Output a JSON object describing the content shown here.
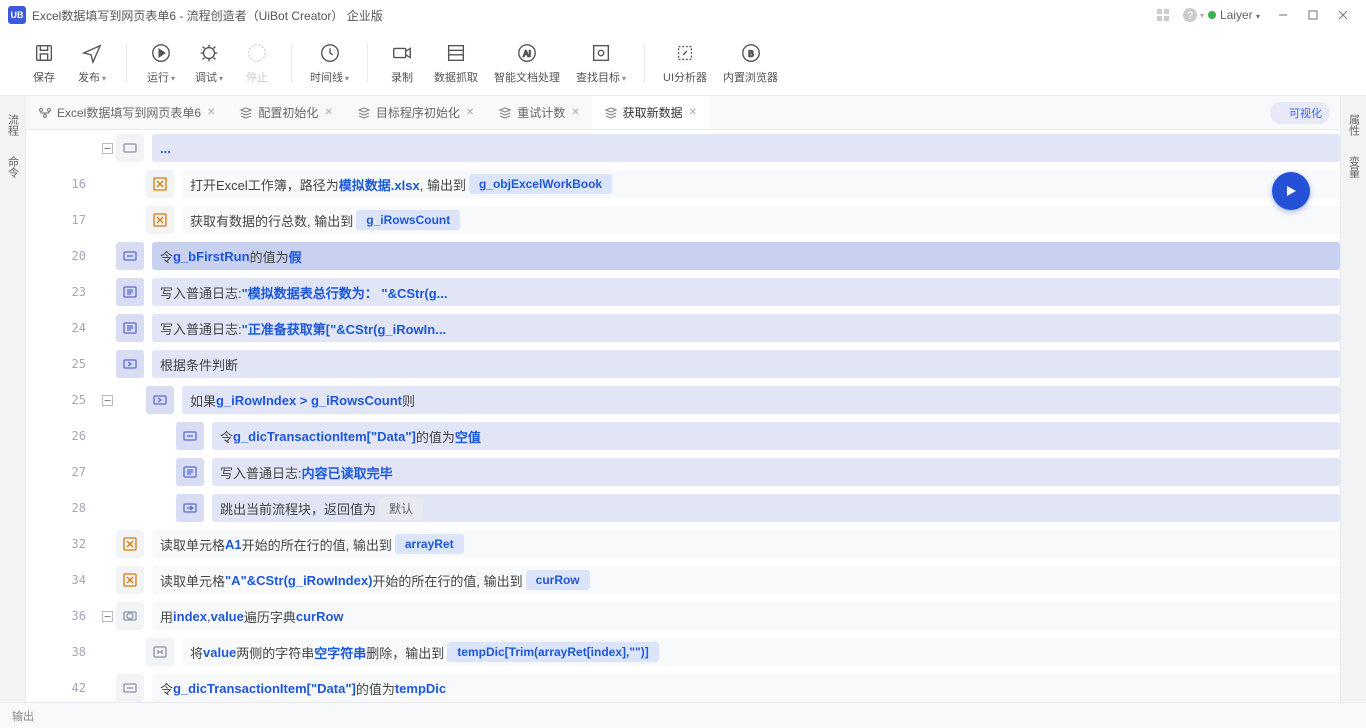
{
  "title": "Excel数据填写到网页表单6 - 流程创造者（UiBot Creator）  企业版",
  "user": "Laiyer",
  "toolbar": [
    {
      "id": "save",
      "label": "保存",
      "svg": "save"
    },
    {
      "id": "pub",
      "label": "发布",
      "svg": "send",
      "dd": true
    },
    {
      "sep": true
    },
    {
      "id": "run",
      "label": "运行",
      "svg": "play",
      "dd": true
    },
    {
      "id": "dbg",
      "label": "调试",
      "svg": "bug",
      "dd": true
    },
    {
      "id": "stop",
      "label": "停止",
      "svg": "stop",
      "disabled": true
    },
    {
      "sep": true
    },
    {
      "id": "tl",
      "label": "时间线",
      "svg": "clock",
      "dd": true
    },
    {
      "sep": true
    },
    {
      "id": "rec",
      "label": "录制",
      "svg": "rec"
    },
    {
      "id": "grab",
      "label": "数据抓取",
      "svg": "grab"
    },
    {
      "id": "ai",
      "label": "智能文档处理",
      "svg": "ai"
    },
    {
      "id": "find",
      "label": "查找目标",
      "svg": "find",
      "dd": true
    },
    {
      "sep": true
    },
    {
      "id": "uia",
      "label": "UI分析器",
      "svg": "uia"
    },
    {
      "id": "br",
      "label": "内置浏览器",
      "svg": "br"
    }
  ],
  "tabs": [
    {
      "label": "Excel数据填写到网页表单6",
      "icon": "flow",
      "close": true
    },
    {
      "label": "配置初始化",
      "icon": "stack",
      "close": true
    },
    {
      "label": "目标程序初始化",
      "icon": "stack",
      "close": true
    },
    {
      "label": "重试计数",
      "icon": "stack",
      "close": true
    },
    {
      "label": "获取新数据",
      "icon": "stack",
      "close": true,
      "active": true
    }
  ],
  "switch_label": "可视化",
  "left_tabs": [
    "流程",
    "命令"
  ],
  "right_tabs": [
    "属性",
    "变量"
  ],
  "status": "输出",
  "lines": [
    {
      "n": "",
      "indent": 0,
      "iconbg": "norm",
      "fold": "-",
      "kind": "headcut",
      "parts": [
        {
          "t": "...",
          "c": "token-bold"
        }
      ],
      "hl": true
    },
    {
      "n": "16",
      "indent": 1,
      "iconbg": "excel",
      "kind": "excel",
      "parts": [
        {
          "t": "打开Excel工作簿，路径为 "
        },
        {
          "t": "模拟数据.xlsx",
          "c": "token-bold"
        },
        {
          "t": " , 输出到 "
        },
        {
          "pill": "g_objExcelWorkBook"
        }
      ]
    },
    {
      "n": "17",
      "indent": 1,
      "iconbg": "excel",
      "kind": "excel",
      "parts": [
        {
          "t": "获取有数据的行总数, 输出到 "
        },
        {
          "pill": "g_iRowsCount"
        }
      ]
    },
    {
      "n": "20",
      "indent": 0,
      "iconbg": "sel",
      "kind": "assign",
      "sel": true,
      "parts": [
        {
          "t": "令 "
        },
        {
          "t": "g_bFirstRun",
          "c": "token-bold"
        },
        {
          "t": " 的值为 "
        },
        {
          "t": "假",
          "c": "token-bold"
        }
      ]
    },
    {
      "n": "23",
      "indent": 0,
      "iconbg": "sel",
      "kind": "log",
      "hl": true,
      "parts": [
        {
          "t": "写入普通日志: "
        },
        {
          "t": "\"模拟数据表总行数为：  \"&CStr(g...",
          "c": "token-str"
        }
      ]
    },
    {
      "n": "24",
      "indent": 0,
      "iconbg": "sel",
      "kind": "log",
      "hl": true,
      "parts": [
        {
          "t": "写入普通日志: "
        },
        {
          "t": "\"正准备获取第[\"&CStr(g_iRowIn...",
          "c": "token-str"
        }
      ]
    },
    {
      "n": "25",
      "indent": 0,
      "iconbg": "sel",
      "kind": "branch",
      "hl": true,
      "parts": [
        {
          "t": "根据条件判断"
        }
      ]
    },
    {
      "n": "25",
      "indent": 1,
      "iconbg": "sel",
      "fold": "-",
      "kind": "branch",
      "hl": true,
      "parts": [
        {
          "t": "如果 "
        },
        {
          "t": "g_iRowIndex > g_iRowsCount",
          "c": "token-bold"
        },
        {
          "t": " 则"
        }
      ]
    },
    {
      "n": "26",
      "indent": 2,
      "iconbg": "sel",
      "kind": "assign",
      "hl": true,
      "parts": [
        {
          "t": "令 "
        },
        {
          "t": "g_dicTransactionItem[\"Data\"]",
          "c": "token-bold"
        },
        {
          "t": " 的值为 "
        },
        {
          "t": "空值",
          "c": "token-bold"
        }
      ]
    },
    {
      "n": "27",
      "indent": 2,
      "iconbg": "sel",
      "kind": "log",
      "hl": true,
      "parts": [
        {
          "t": "写入普通日志: "
        },
        {
          "t": "内容已读取完毕",
          "c": "token-str"
        }
      ]
    },
    {
      "n": "28",
      "indent": 2,
      "iconbg": "sel",
      "kind": "exit",
      "hl": true,
      "parts": [
        {
          "t": "跳出当前流程块，返回值为 "
        },
        {
          "pillgray": "默认"
        }
      ]
    },
    {
      "n": "32",
      "indent": 0,
      "iconbg": "excel",
      "kind": "excel",
      "parts": [
        {
          "t": "读取单元格 "
        },
        {
          "t": "A1",
          "c": "token-bold"
        },
        {
          "t": " 开始的所在行的值, 输出到 "
        },
        {
          "pill": "arrayRet"
        }
      ]
    },
    {
      "n": "34",
      "indent": 0,
      "iconbg": "excel",
      "kind": "excel",
      "parts": [
        {
          "t": "读取单元格 "
        },
        {
          "t": "\"A\"&CStr(g_iRowIndex)",
          "c": "token-bold"
        },
        {
          "t": " 开始的所在行的值, 输出到 "
        },
        {
          "pill": "curRow"
        }
      ]
    },
    {
      "n": "36",
      "indent": 0,
      "iconbg": "norm",
      "fold": "-",
      "kind": "loop",
      "parts": [
        {
          "t": "用 "
        },
        {
          "t": "index",
          "c": "token-bold"
        },
        {
          "t": " , "
        },
        {
          "t": "value",
          "c": "token-bold"
        },
        {
          "t": " 遍历字典 "
        },
        {
          "t": "curRow",
          "c": "token-bold"
        }
      ]
    },
    {
      "n": "38",
      "indent": 1,
      "iconbg": "norm",
      "kind": "str",
      "parts": [
        {
          "t": "将 "
        },
        {
          "t": "value",
          "c": "token-bold"
        },
        {
          "t": " 两侧的字符串 "
        },
        {
          "t": "空字符串",
          "c": "token-bold"
        },
        {
          "t": " 删除，输出到 "
        },
        {
          "pill": "tempDic[Trim(arrayRet[index],\"\")]"
        }
      ]
    },
    {
      "n": "42",
      "indent": 0,
      "iconbg": "norm",
      "kind": "assign",
      "parts": [
        {
          "t": "令 "
        },
        {
          "t": "g_dicTransactionItem[\"Data\"]",
          "c": "token-bold"
        },
        {
          "t": " 的值为 "
        },
        {
          "t": "tempDic",
          "c": "token-bold"
        }
      ]
    }
  ]
}
